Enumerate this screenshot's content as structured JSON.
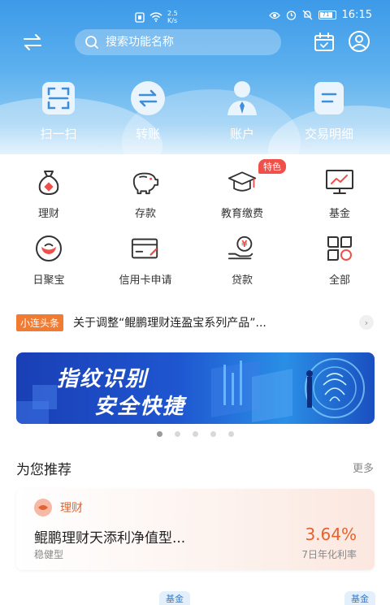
{
  "status_bar": {
    "speed_value": "2.5",
    "speed_unit": "K/s",
    "battery": "71",
    "time": "16:15"
  },
  "search": {
    "placeholder": "搜索功能名称"
  },
  "quick_actions": [
    {
      "label": "扫一扫",
      "icon": "scan-icon"
    },
    {
      "label": "转账",
      "icon": "transfer-icon"
    },
    {
      "label": "账户",
      "icon": "account-icon"
    },
    {
      "label": "交易明细",
      "icon": "transaction-detail-icon"
    }
  ],
  "services": [
    {
      "label": "理财",
      "icon": "money-bag-icon"
    },
    {
      "label": "存款",
      "icon": "piggy-bank-icon"
    },
    {
      "label": "教育缴费",
      "icon": "graduation-cap-icon"
    },
    {
      "label": "基金",
      "icon": "fund-chart-icon"
    },
    {
      "label": "日聚宝",
      "icon": "ingot-icon"
    },
    {
      "label": "信用卡申请",
      "icon": "credit-card-icon"
    },
    {
      "label": "贷款",
      "icon": "loan-icon"
    },
    {
      "label": "全部",
      "icon": "all-apps-icon"
    }
  ],
  "special_tag": "特色",
  "news": {
    "tag": "小连头条",
    "text": "关于调整“鲲鹏理财连盈宝系列产品”..."
  },
  "banner": {
    "line1": "指纹识别",
    "line2": "安全快捷"
  },
  "carousel": {
    "count": 5,
    "active_index": 0
  },
  "recommend": {
    "title": "为您推荐",
    "more": "更多",
    "card": {
      "category": "理财",
      "name": "鲲鹏理财天添利净值型...",
      "risk": "稳健型",
      "rate": "3.64%",
      "rate_label": "7日年化利率"
    },
    "next_tags": [
      "基金",
      "基金"
    ]
  },
  "colors": {
    "header_blue": "#3d9ae8",
    "accent_orange": "#e2632f",
    "news_tag": "#f07b33",
    "special_red": "#f0504a"
  }
}
